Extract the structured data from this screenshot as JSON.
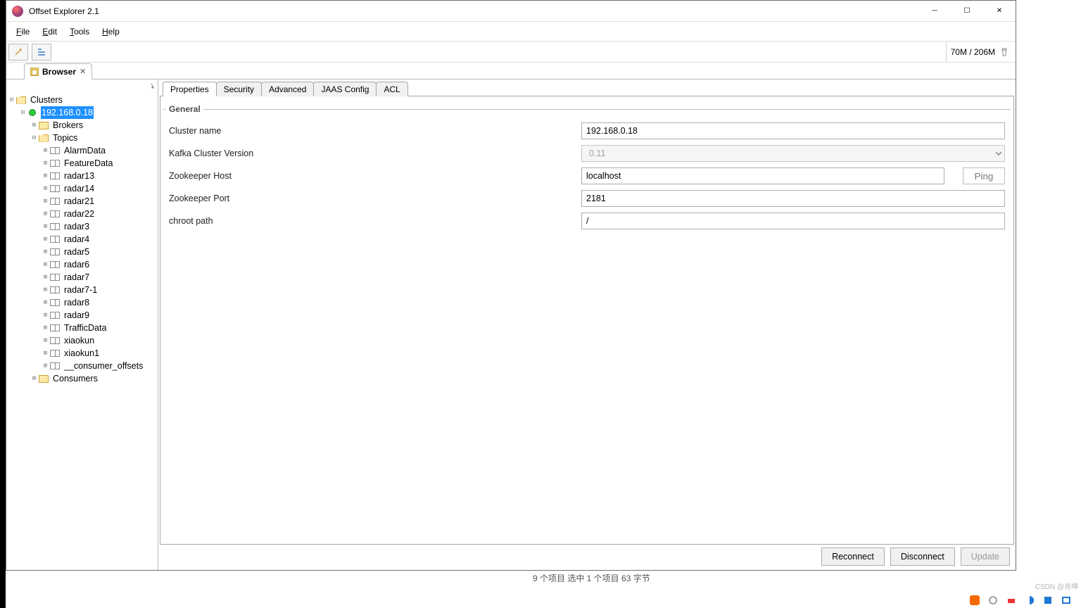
{
  "window": {
    "title": "Offset Explorer  2.1"
  },
  "menu": {
    "file": "File",
    "edit": "Edit",
    "tools": "Tools",
    "help": "Help"
  },
  "memory": {
    "label": "70M / 206M"
  },
  "doc_tab": {
    "label": "Browser"
  },
  "tree": {
    "root": "Clusters",
    "cluster": "192.168.0.18",
    "brokers": "Brokers",
    "topics_label": "Topics",
    "consumers": "Consumers",
    "topics": [
      "AlarmData",
      "FeatureData",
      "radar13",
      "radar14",
      "radar21",
      "radar22",
      "radar3",
      "radar4",
      "radar5",
      "radar6",
      "radar7",
      "radar7-1",
      "radar8",
      "radar9",
      "TrafficData",
      "xiaokun",
      "xiaokun1",
      "__consumer_offsets"
    ]
  },
  "tabs": {
    "t0": "Properties",
    "t1": "Security",
    "t2": "Advanced",
    "t3": "JAAS Config",
    "t4": "ACL"
  },
  "form": {
    "legend": "General",
    "cluster_name_label": "Cluster name",
    "cluster_name_value": "192.168.0.18",
    "version_label": "Kafka Cluster Version",
    "version_value": "0.11",
    "zk_host_label": "Zookeeper Host",
    "zk_host_value": "localhost",
    "ping_label": "Ping",
    "zk_port_label": "Zookeeper Port",
    "zk_port_value": "2181",
    "chroot_label": "chroot path",
    "chroot_value": "/"
  },
  "actions": {
    "reconnect": "Reconnect",
    "disconnect": "Disconnect",
    "update": "Update"
  },
  "taskbar_fragment": "9 个项目    选中 1 个项目  63 字节",
  "watermark": "CSDN @肖坤"
}
